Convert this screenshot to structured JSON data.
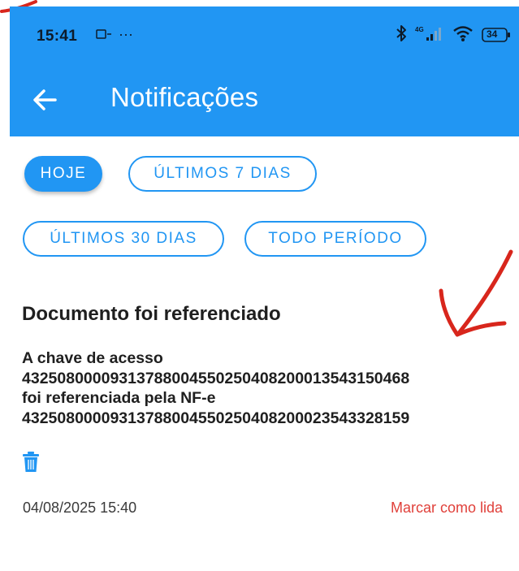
{
  "status_bar": {
    "time": "15:41",
    "indicator_dots": "···",
    "battery_level": "34",
    "icons": [
      "sim-icon",
      "bluetooth-icon",
      "signal-icon",
      "wifi-icon",
      "battery-icon"
    ]
  },
  "app_bar": {
    "title": "Notificações",
    "back_icon": "arrow-left-icon"
  },
  "filters": [
    {
      "label": "HOJE",
      "selected": true
    },
    {
      "label": "ÚLTIMOS 7 DIAS",
      "selected": false
    },
    {
      "label": "ÚLTIMOS 30 DIAS",
      "selected": false
    },
    {
      "label": "TODO PERÍODO",
      "selected": false
    }
  ],
  "notification": {
    "title": "Documento foi referenciado",
    "body_lines": [
      "A chave de acesso",
      "43250800009313788004550250408200013543150468",
      "foi referenciada pela NF-e",
      "43250800009313788004550250408200023543328159"
    ],
    "date": "04/08/2025 15:40",
    "mark_read_label": "Marcar como lida",
    "delete_icon": "trash-icon"
  },
  "colors": {
    "primary": "#2196f3",
    "accent_red": "#e0403a",
    "annotation_red": "#d8261c",
    "text_dark": "#1f1f1f"
  }
}
